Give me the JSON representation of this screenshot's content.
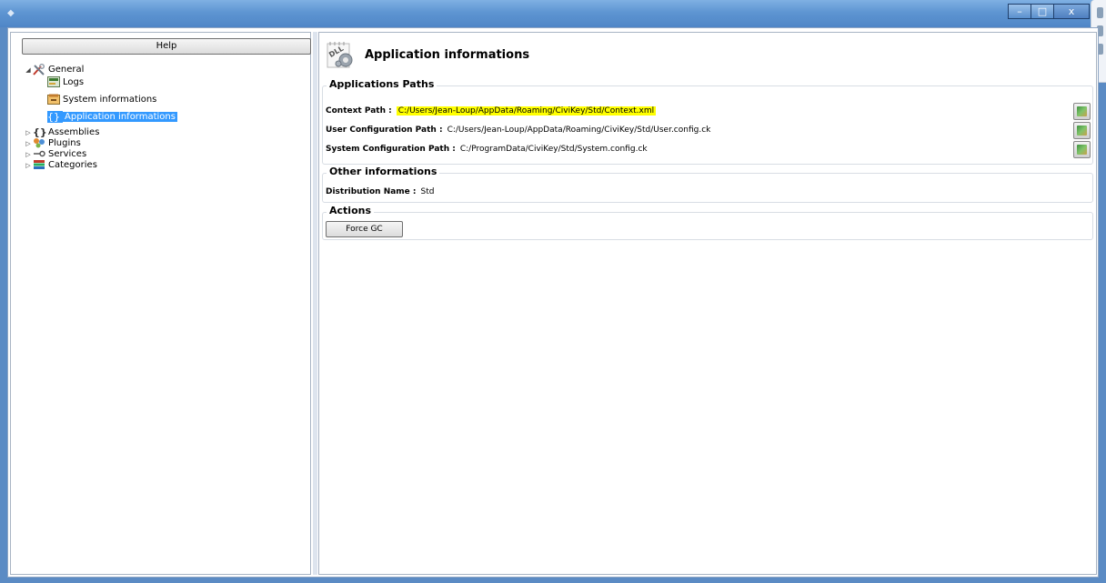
{
  "window": {
    "title": "",
    "buttons": {
      "minimize": "–",
      "maximize": "□",
      "close": "x"
    }
  },
  "left": {
    "help_label": "Help",
    "tree": [
      {
        "label": "General",
        "icon": "tools-icon",
        "expander": "◢"
      },
      {
        "label": "Logs",
        "icon": "logs-icon"
      },
      {
        "label": "System informations",
        "icon": "system-info-icon"
      },
      {
        "label": "Application informations",
        "icon": "braces-icon",
        "selected": true
      },
      {
        "label": "Assemblies",
        "icon": "braces-icon",
        "expander": "▷"
      },
      {
        "label": "Plugins",
        "icon": "plugins-icon",
        "expander": "▷"
      },
      {
        "label": "Services",
        "icon": "service-icon",
        "expander": "▷"
      },
      {
        "label": "Categories",
        "icon": "books-icon",
        "expander": "▷"
      }
    ]
  },
  "right": {
    "icon_label": "DLL",
    "title": "Application informations",
    "paths_group": {
      "title": "Applications Paths",
      "rows": [
        {
          "label": "Context Path :",
          "value": "C:/Users/Jean-Loup/AppData/Roaming/CiviKey/Std/Context.xml"
        },
        {
          "label": "User Configuration Path :",
          "value": "C:/Users/Jean-Loup/AppData/Roaming/CiviKey/Std/User.config.ck"
        },
        {
          "label": "System Configuration Path :",
          "value": "C:/ProgramData/CiviKey/Std/System.config.ck"
        }
      ]
    },
    "other_group": {
      "title": "Other informations",
      "label": "Distribution Name :",
      "value": "Std"
    },
    "actions_group": {
      "title": "Actions",
      "button": "Force GC"
    }
  }
}
